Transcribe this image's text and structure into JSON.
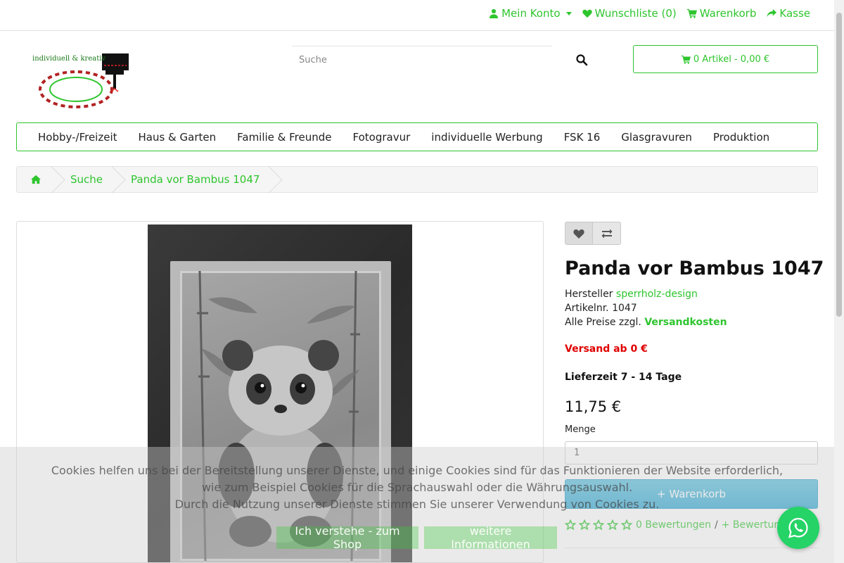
{
  "topnav": {
    "account": "Mein Konto",
    "wishlist": "Wunschliste (0)",
    "cart": "Warenkorb",
    "checkout": "Kasse"
  },
  "logo": {
    "text": "individuell & kreativ"
  },
  "search": {
    "placeholder": "Suche"
  },
  "cart_summary": "0 Artikel - 0,00 €",
  "categories": [
    "Hobby-/Freizeit",
    "Haus & Garten",
    "Familie & Freunde",
    "Fotogravur",
    "individuelle Werbung",
    "FSK 16",
    "Glasgravuren",
    "Produktion"
  ],
  "breadcrumb": [
    "Suche",
    "Panda vor Bambus 1047"
  ],
  "product": {
    "title": "Panda vor Bambus 1047",
    "manufacturer_label": "Hersteller",
    "manufacturer": "sperrholz-design",
    "article_label": "Artikelnr.",
    "article_no": "1047",
    "prices_note": "Alle Preise zzgl.",
    "shipping_link": "Versandkosten",
    "shipping_from": "Versand ab 0 €",
    "delivery": "Lieferzeit 7 - 14 Tage",
    "price": "11,75 €",
    "qty_label": "Menge",
    "qty_value": "1",
    "add_to_cart": "+ Warenkorb",
    "reviews_count": "0 Bewertungen",
    "reviews_sep": "/",
    "add_review": "+ Bewertung",
    "rating": 0,
    "rating_max": 5
  },
  "cookie": {
    "line1": "Cookies helfen uns bei der Bereitstellung unserer Dienste, und einige Cookies sind für das Funktionieren der Website erforderlich,",
    "line2": "wie zum Beispiel Cookies für die Sprachauswahl oder die Währungsauswahl.",
    "line3": "Durch die Nutzung unserer Dienste stimmen Sie unserer Verwendung von Cookies zu.",
    "accept": "Ich verstehe - zum Shop",
    "more": "weitere Informationen"
  },
  "colors": {
    "accent": "#2ec52e",
    "price_red": "#e00000",
    "cart_button": "#31a9d4",
    "whatsapp": "#25d366"
  }
}
